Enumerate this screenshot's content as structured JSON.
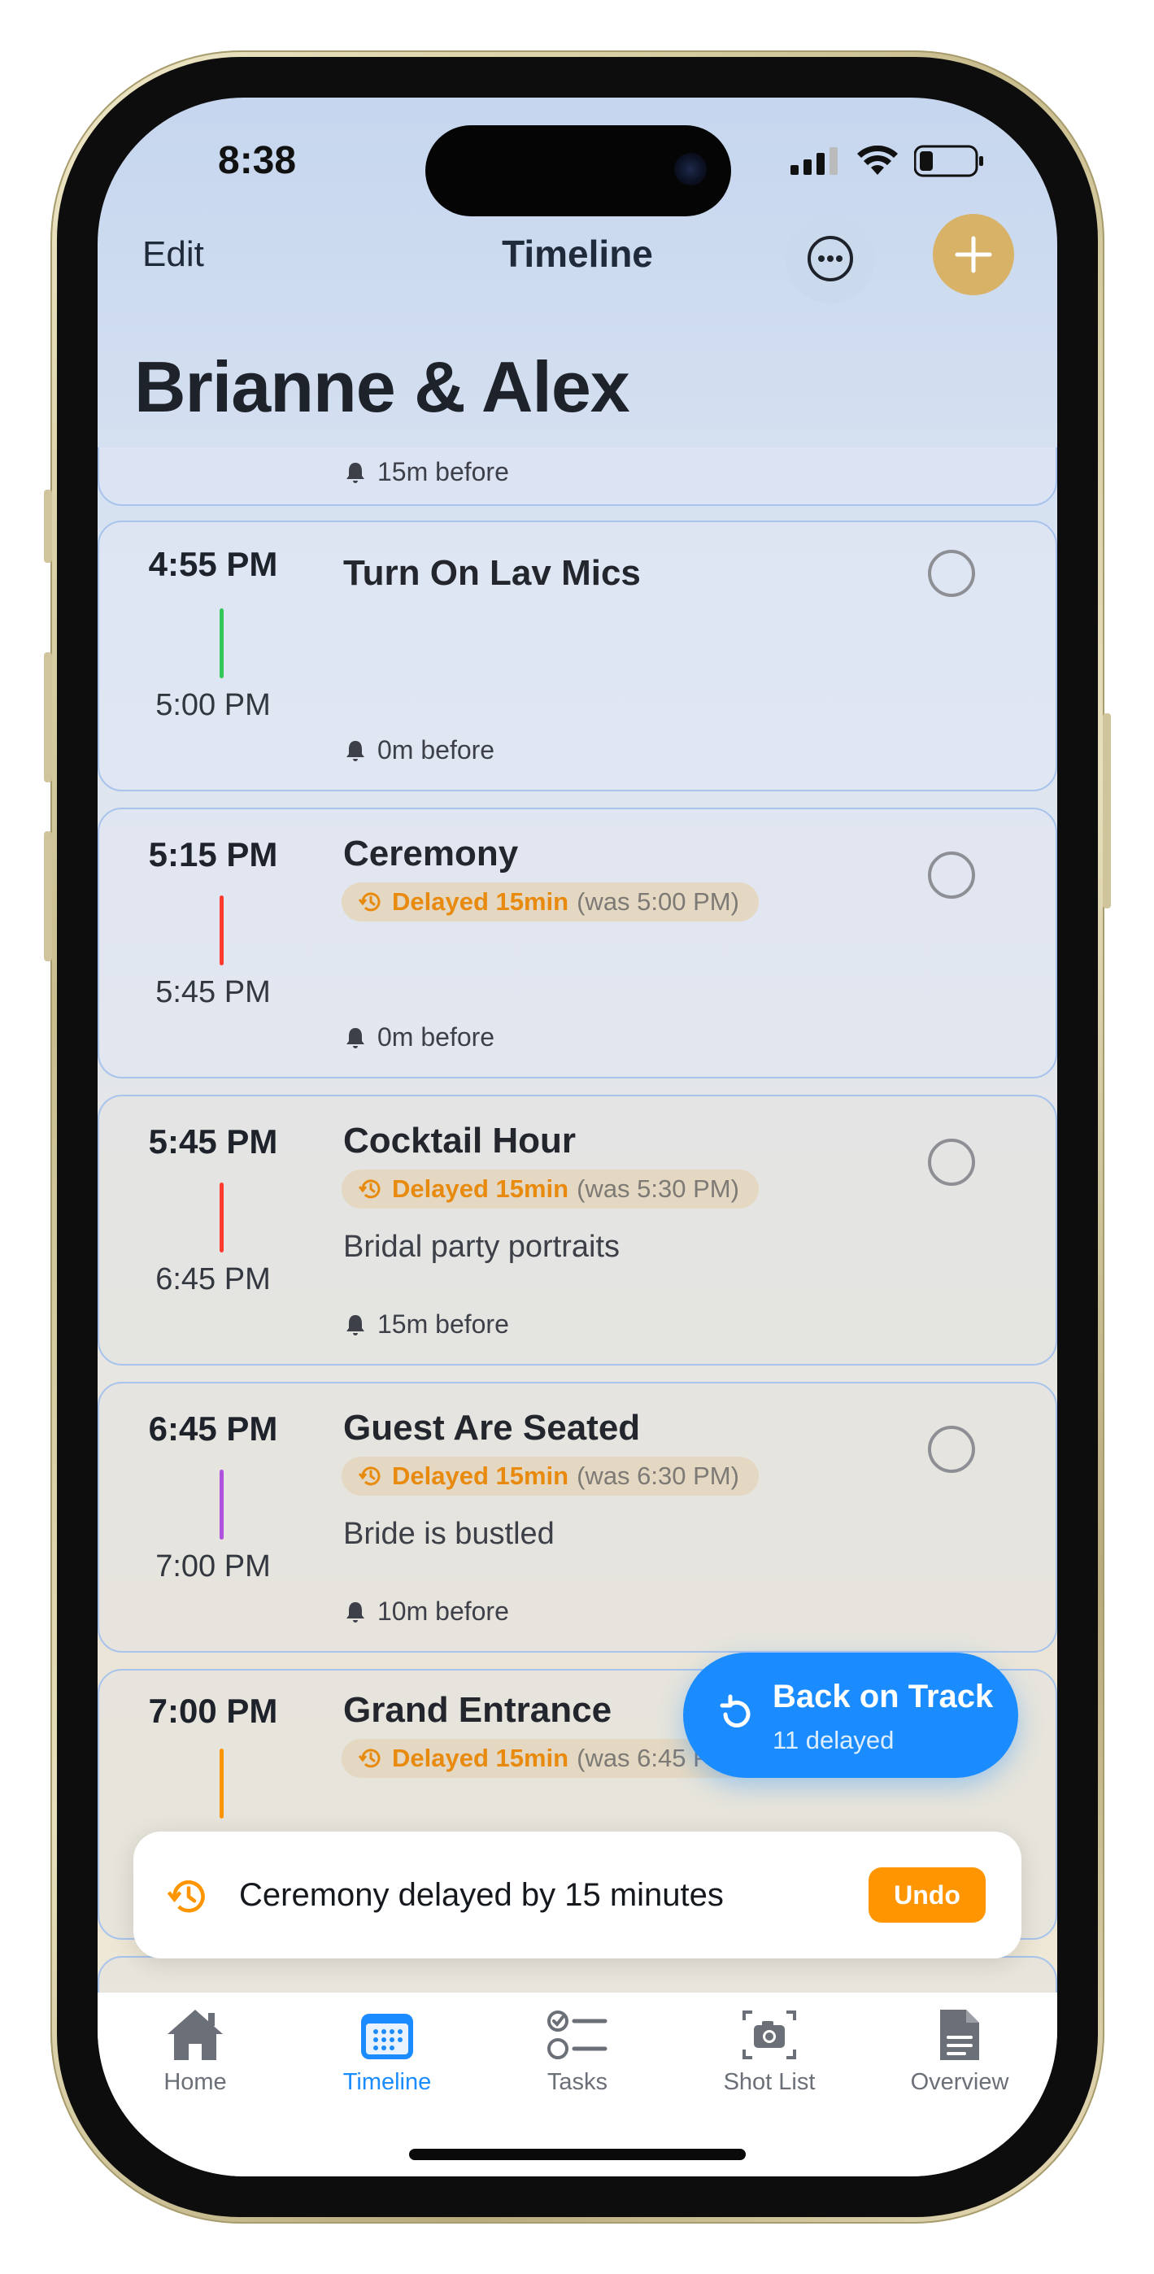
{
  "status_bar": {
    "time": "8:38"
  },
  "nav": {
    "edit_label": "Edit",
    "title": "Timeline"
  },
  "header": {
    "couple": "Brianne & Alex"
  },
  "events": [
    {
      "start": "",
      "end": "",
      "title": "",
      "reminder": "15m before"
    },
    {
      "start": "4:55 PM",
      "end": "5:00 PM",
      "title": "Turn On Lav Mics",
      "bar_color": "#34c759",
      "reminder": "0m before"
    },
    {
      "start": "5:15 PM",
      "end": "5:45 PM",
      "title": "Ceremony",
      "bar_color": "#ff3b30",
      "delay": "Delayed 15min",
      "was": "(was 5:00 PM)",
      "reminder": "0m before"
    },
    {
      "start": "5:45 PM",
      "end": "6:45 PM",
      "title": "Cocktail Hour",
      "bar_color": "#ff3b30",
      "delay": "Delayed 15min",
      "was": "(was 5:30 PM)",
      "note": "Bridal party portraits",
      "reminder": "15m before"
    },
    {
      "start": "6:45 PM",
      "end": "7:00 PM",
      "title": "Guest Are Seated",
      "bar_color": "#af52de",
      "delay": "Delayed 15min",
      "was": "(was 6:30 PM)",
      "note": "Bride is bustled",
      "reminder": "10m before"
    },
    {
      "start": "7:00 PM",
      "end": "",
      "title": "Grand Entrance",
      "bar_color": "#ff9500",
      "delay": "Delayed 15min",
      "was": "(was 6:45 PM)"
    }
  ],
  "fab": {
    "title": "Back on Track",
    "subtitle": "11 delayed"
  },
  "toast": {
    "message": "Ceremony delayed by 15 minutes",
    "action": "Undo"
  },
  "tabs": [
    {
      "label": "Home",
      "icon": "house-icon"
    },
    {
      "label": "Timeline",
      "icon": "calendar-icon",
      "active": true
    },
    {
      "label": "Tasks",
      "icon": "checklist-icon"
    },
    {
      "label": "Shot List",
      "icon": "camera-icon"
    },
    {
      "label": "Overview",
      "icon": "document-icon"
    }
  ],
  "colors": {
    "accent": "#1a8cff",
    "delay": "#e88a0e",
    "add_button": "#d8b266",
    "undo": "#ff9500"
  }
}
